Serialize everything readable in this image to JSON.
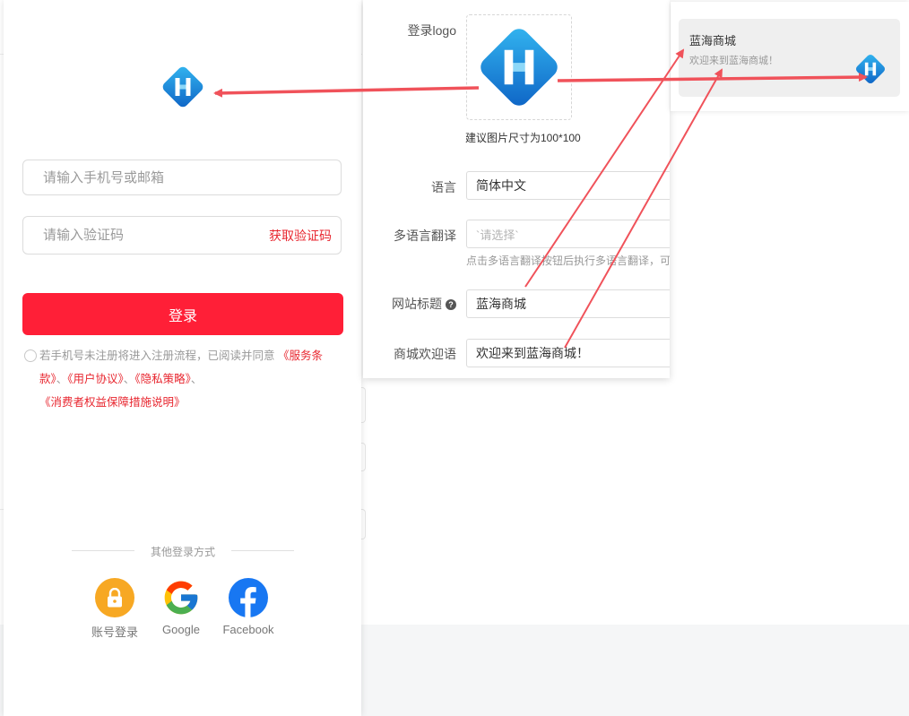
{
  "colors": {
    "brand_red": "#ff1f37",
    "link_red": "#e8262f",
    "logo_blue_light": "#33b6f0",
    "logo_blue_dark": "#0e63c5",
    "annotation_arrow": "#f0525a",
    "account_login_orange": "#f7a823",
    "facebook_blue": "#1877f2"
  },
  "login": {
    "logo_icon": "brand-h-logo",
    "phone_placeholder": "请输入手机号或邮箱",
    "code_placeholder": "请输入验证码",
    "get_code_label": "获取验证码",
    "login_button_label": "登录",
    "agreement_prefix": "若手机号未注册将进入注册流程，已阅读并同意",
    "agreement_links": [
      "《服务条款》",
      "《用户协议》",
      "《隐私策略》",
      "《消费者权益保障措施说明》"
    ],
    "agreement_separator": "、",
    "other_methods_title": "其他登录方式",
    "methods": [
      {
        "label": "账号登录",
        "icon": "lock-icon"
      },
      {
        "label": "Google",
        "icon": "google-icon"
      },
      {
        "label": "Facebook",
        "icon": "facebook-icon"
      }
    ]
  },
  "settings": {
    "logo_label": "登录logo",
    "logo_size_hint": "建议图片尺寸为100*100",
    "language_label": "语言",
    "language_value": "简体中文",
    "translation_label": "多语言翻译",
    "translation_placeholder": "`请选择`",
    "translation_help": "点击多语言翻译按钮后执行多语言翻译，可",
    "site_title_label": "网站标题",
    "site_title_value": "蓝海商城",
    "welcome_label": "商城欢迎语",
    "welcome_value": "欢迎来到蓝海商城！"
  },
  "preview": {
    "title": "蓝海商城",
    "welcome": "欢迎来到蓝海商城！"
  }
}
